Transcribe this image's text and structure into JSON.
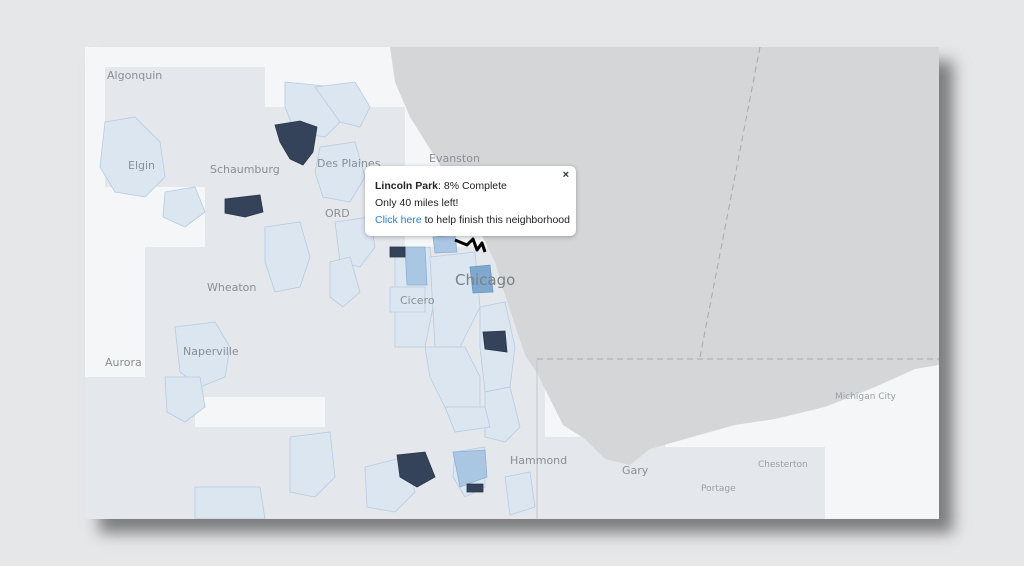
{
  "map": {
    "labels": {
      "algonquin": "Algonquin",
      "elgin": "Elgin",
      "schaumburg": "Schaumburg",
      "des_plaines": "Des Plaines",
      "evanston": "Evanston",
      "ord": "ORD",
      "wheaton": "Wheaton",
      "chicago": "Chicago",
      "cicero": "Cicero",
      "aurora": "Aurora",
      "naperville": "Naperville",
      "hammond": "Hammond",
      "gary": "Gary",
      "michigan_city": "Michigan City",
      "chesterton": "Chesterton",
      "portage": "Portage"
    }
  },
  "popup": {
    "neighborhood": "Lincoln Park",
    "progress_text": ": 8% Complete",
    "progress_percent": 8,
    "remaining_text": "Only 40 miles left!",
    "link_text": "Click here",
    "link_suffix": " to help finish this neighborhood",
    "close_symbol": "×"
  },
  "colors": {
    "page_background": "#e6e7e9",
    "land": "#f4f6f8",
    "water": "#d5d6d8",
    "urban_grey": "#e3e6ea",
    "region_light": "#dbe6f1",
    "region_medium": "#a9c6e3",
    "region_mid_blue": "#7fa8cf",
    "region_dark": "#34435a",
    "link": "#2a7fd4"
  }
}
